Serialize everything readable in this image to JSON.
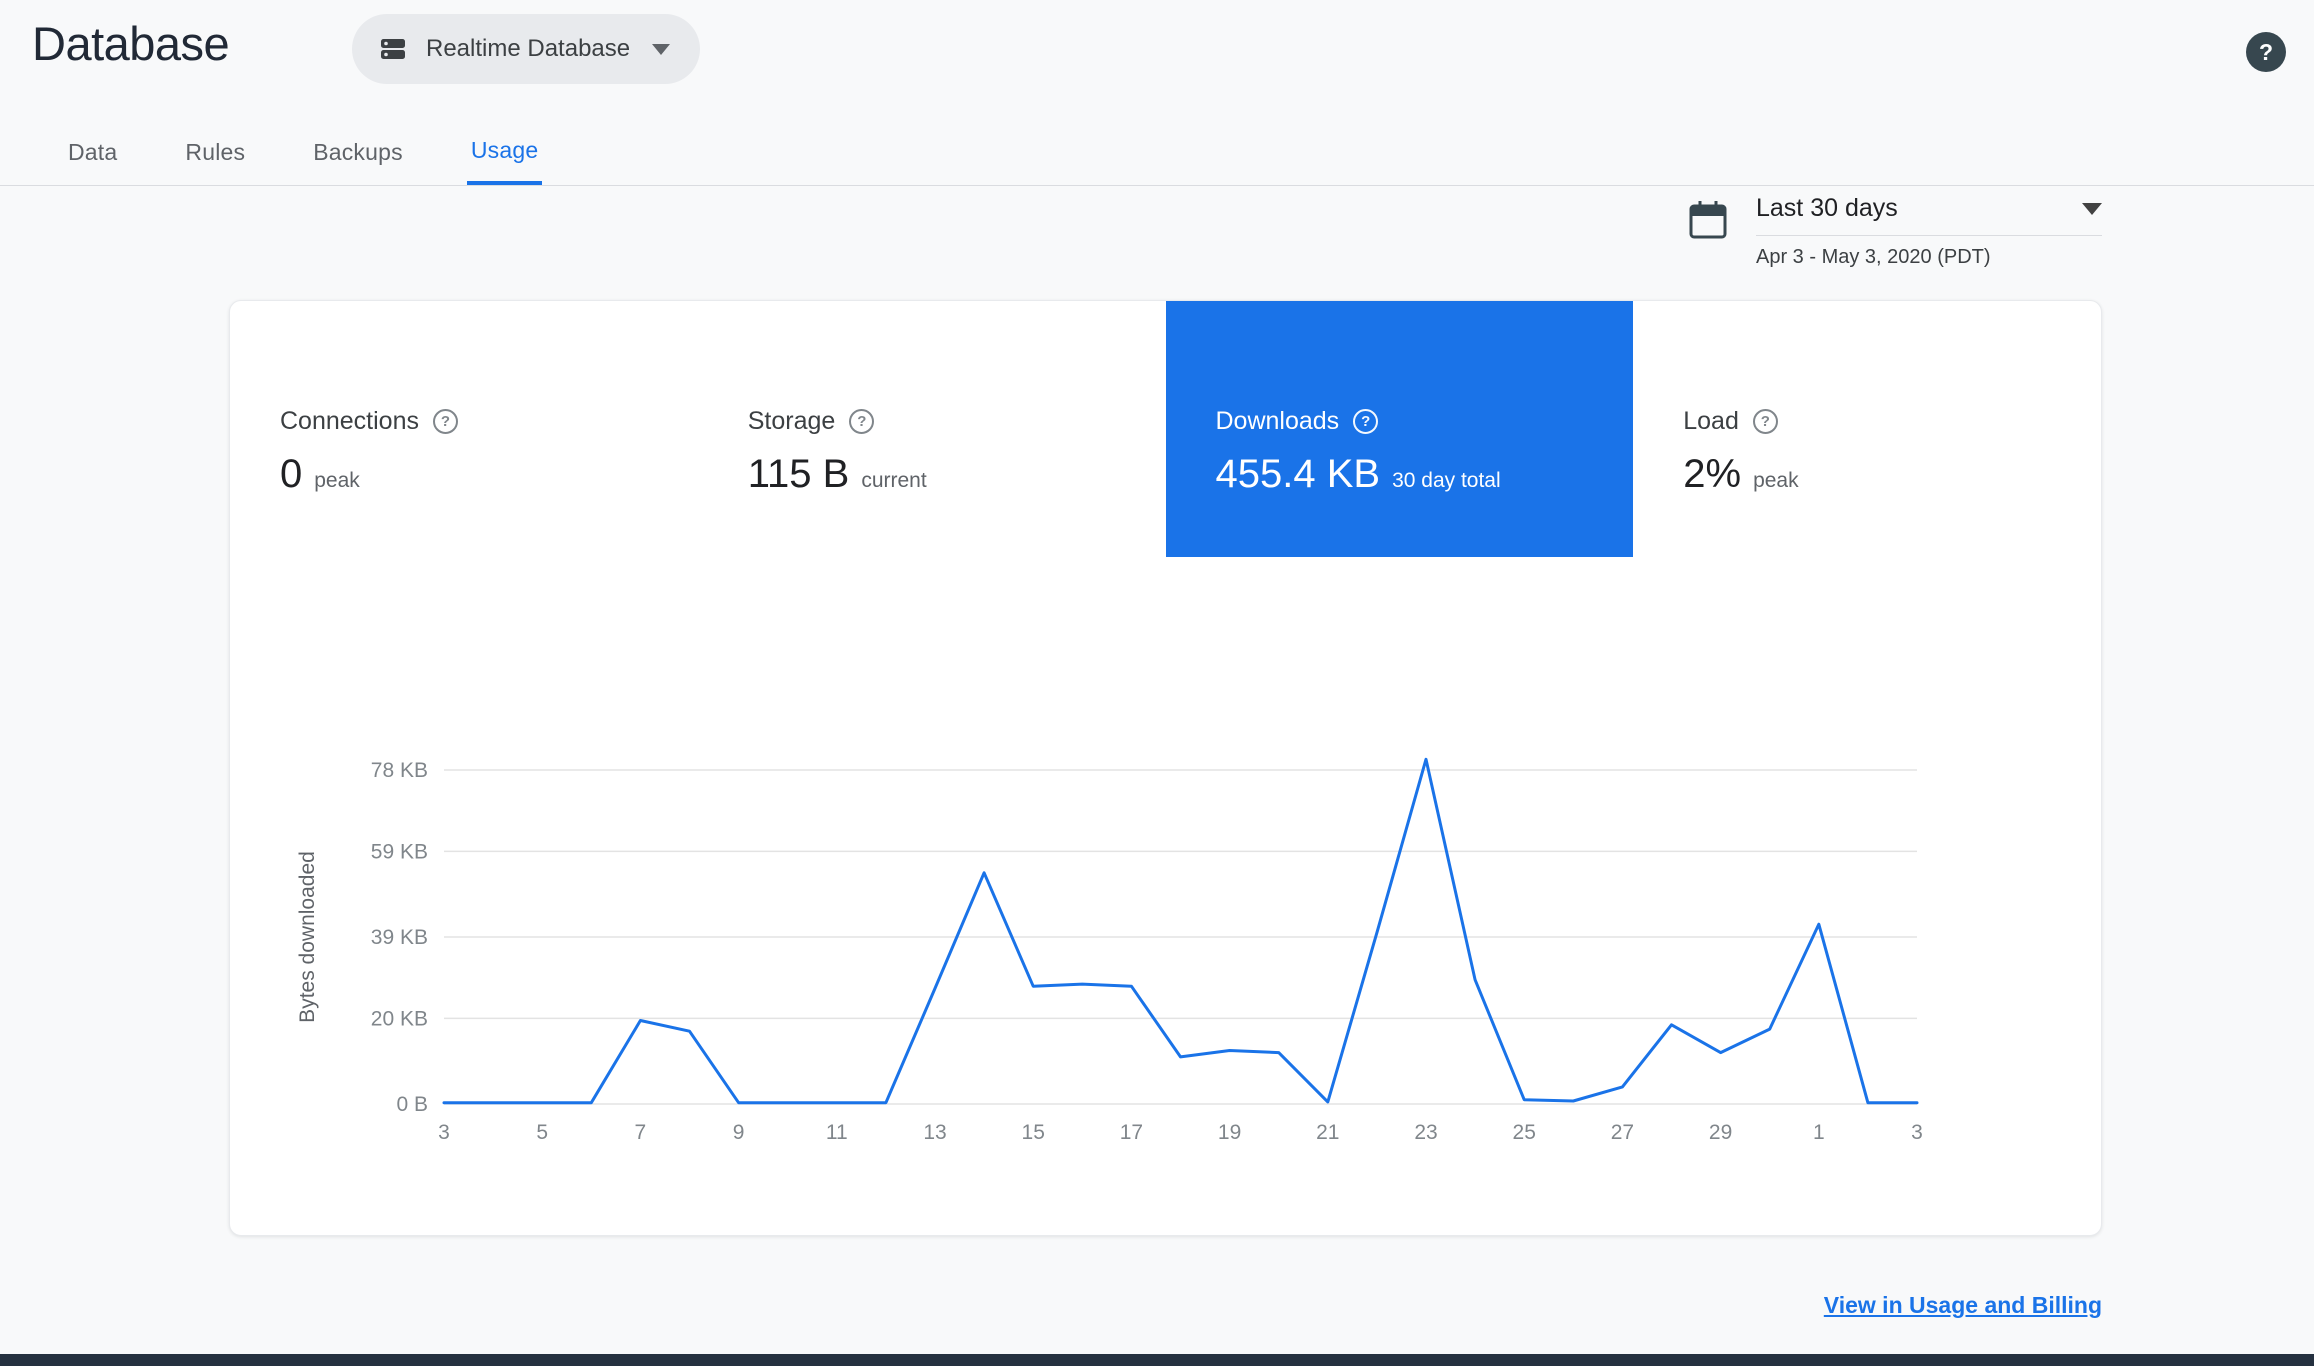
{
  "header": {
    "title": "Database",
    "database_selector": {
      "label": "Realtime Database"
    }
  },
  "tabs": [
    {
      "label": "Data",
      "active": false
    },
    {
      "label": "Rules",
      "active": false
    },
    {
      "label": "Backups",
      "active": false
    },
    {
      "label": "Usage",
      "active": true
    }
  ],
  "date_range": {
    "label": "Last 30 days",
    "detail": "Apr 3 - May 3, 2020 (PDT)"
  },
  "metrics": [
    {
      "label": "Connections",
      "value": "0",
      "suffix": "peak",
      "selected": false
    },
    {
      "label": "Storage",
      "value": "115 B",
      "suffix": "current",
      "selected": false
    },
    {
      "label": "Downloads",
      "value": "455.4 KB",
      "suffix": "30 day total",
      "selected": true
    },
    {
      "label": "Load",
      "value": "2%",
      "suffix": "peak",
      "selected": false
    }
  ],
  "icons": {
    "help_glyph": "?"
  },
  "colors": {
    "accent": "#1a73e8",
    "selected_tile_bg": "#1a73e8",
    "grid": "#e3e3e3"
  },
  "footer": {
    "link_label": "View in Usage and Billing"
  },
  "chart_data": {
    "type": "line",
    "title": "Downloads (bytes downloaded per day)",
    "ylabel": "Bytes downloaded",
    "xlabel": "",
    "x_range": "Apr 3 - May 3, 2020",
    "xtick_labels": [
      "3",
      "5",
      "7",
      "9",
      "11",
      "13",
      "15",
      "17",
      "19",
      "21",
      "23",
      "25",
      "27",
      "29",
      "1",
      "3"
    ],
    "yticks": [
      {
        "label": "0 B",
        "value": 0
      },
      {
        "label": "20 KB",
        "value": 20
      },
      {
        "label": "39 KB",
        "value": 39
      },
      {
        "label": "59 KB",
        "value": 59
      },
      {
        "label": "78 KB",
        "value": 78
      }
    ],
    "ylim": [
      0,
      78
    ],
    "unit": "KB",
    "values_kb": [
      0.3,
      0.3,
      0.3,
      0.3,
      19.5,
      17,
      0.3,
      0.3,
      0.3,
      0.3,
      27,
      54,
      27.5,
      28,
      27.5,
      11,
      12.5,
      12,
      0.5,
      40,
      80.5,
      29,
      1,
      0.7,
      4,
      18.5,
      12,
      17.5,
      42,
      0.3,
      0.3
    ],
    "line_color": "#1a73e8",
    "grid": true,
    "legend": "none"
  }
}
